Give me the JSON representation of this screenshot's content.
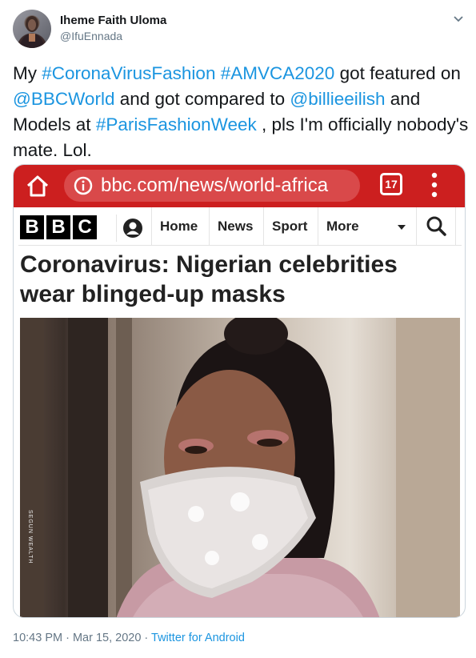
{
  "tweet": {
    "user_name": "Iheme Faith Uloma",
    "user_handle": "@IfuEnnada",
    "text_parts": [
      {
        "text": "My ",
        "link": false
      },
      {
        "text": "#CoronaVirusFashion",
        "link": true
      },
      {
        "text": " ",
        "link": false
      },
      {
        "text": "#AMVCA2020",
        "link": true
      },
      {
        "text": " got featured on ",
        "link": false
      },
      {
        "text": "@BBCWorld",
        "link": true
      },
      {
        "text": " and got compared to ",
        "link": false
      },
      {
        "text": "@billieeilish",
        "link": true
      },
      {
        "text": " and Models at ",
        "link": false
      },
      {
        "text": "#ParisFashionWeek",
        "link": true
      },
      {
        "text": " , pls I'm officially nobody's mate. Lol.",
        "link": false
      }
    ],
    "timestamp": "10:43 PM · Mar 15, 2020 · ",
    "source_app": "Twitter for Android"
  },
  "screenshot": {
    "url": "bbc.com/news/world-africa",
    "tab_count": "17",
    "logo_letters": [
      "B",
      "B",
      "C"
    ],
    "nav": {
      "home": "Home",
      "news": "News",
      "sport": "Sport",
      "more": "More"
    },
    "headline": "Coronavirus: Nigerian celebrities wear blinged-up masks",
    "photo_credit": "SEGUN WEALTH"
  },
  "colors": {
    "link": "#1b95e0",
    "browser_bar": "#cc1f1f",
    "secondary_text": "#657786"
  },
  "icons": [
    "caret-down-icon",
    "home-icon",
    "info-icon",
    "tabs-icon",
    "more-vert-icon",
    "account-icon",
    "search-icon"
  ]
}
